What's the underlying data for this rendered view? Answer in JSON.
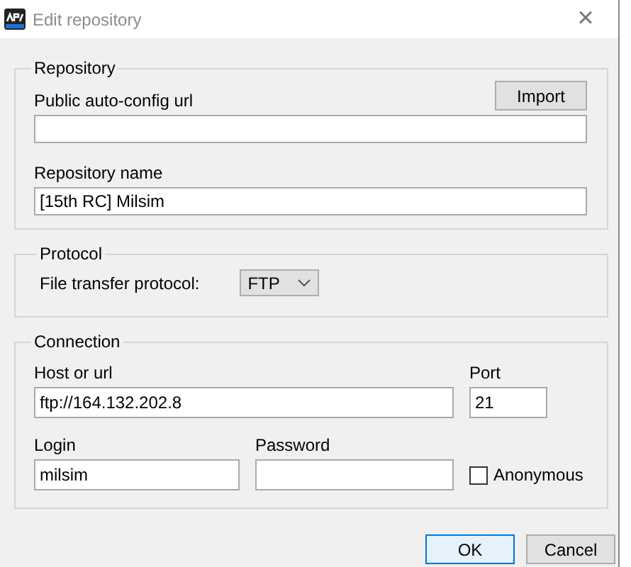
{
  "window": {
    "title": "Edit repository",
    "close": "×"
  },
  "repository": {
    "legend": "Repository",
    "url_label": "Public auto-config url",
    "import_button": "Import",
    "name_label": "Repository name",
    "name_value": "[15th RC] Milsim"
  },
  "protocol": {
    "legend": "Protocol",
    "label": "File transfer protocol:",
    "value": "FTP"
  },
  "connection": {
    "legend": "Connection",
    "host_label": "Host or url",
    "host_value": "ftp://164.132.202.8",
    "port_label": "Port",
    "port_value": "21",
    "login_label": "Login",
    "login_value": "milsim",
    "password_label": "Password",
    "anonymous": {
      "label": "Anonymous",
      "checked": false
    }
  },
  "buttons": [
    {
      "label": "OK",
      "default": true
    },
    {
      "label": "Cancel",
      "default": false
    }
  ]
}
